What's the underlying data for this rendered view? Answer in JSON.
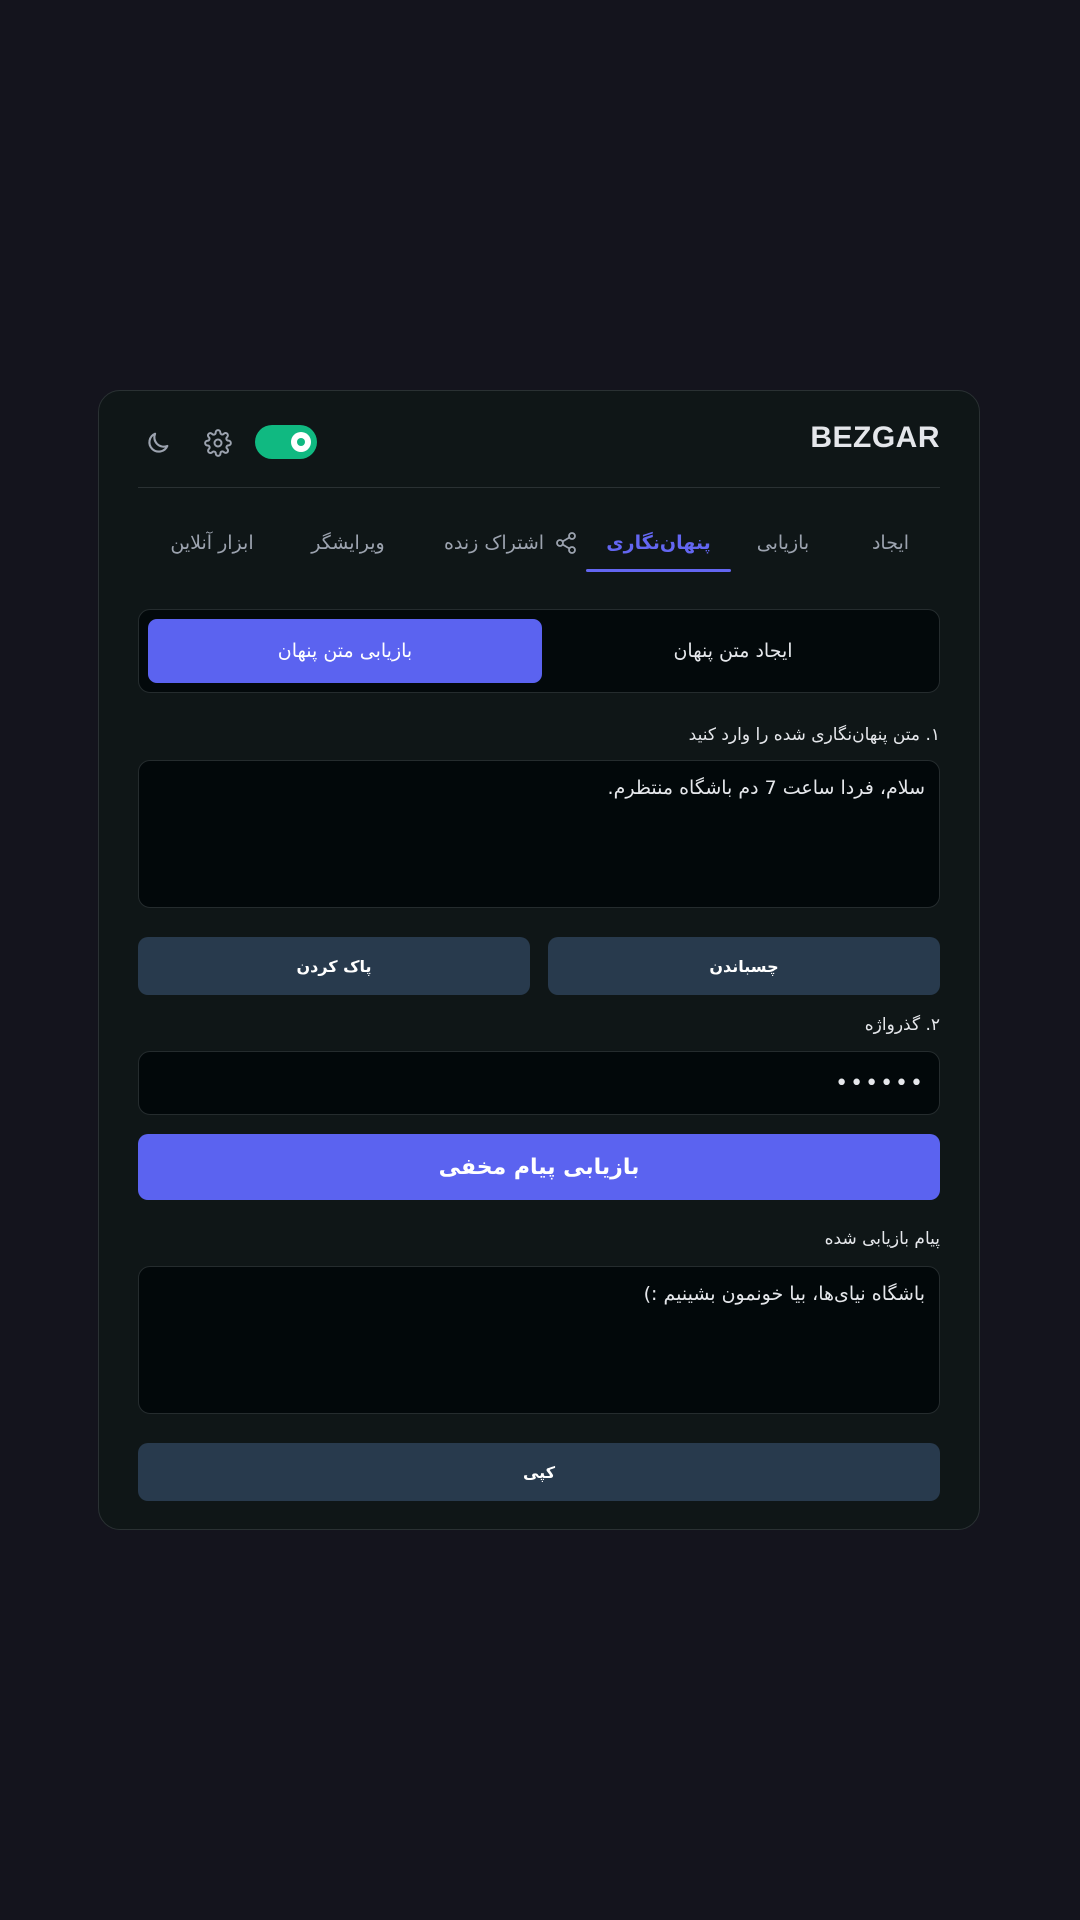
{
  "app": {
    "title": "BEZGAR"
  },
  "header": {
    "theme_icon": "moon-icon",
    "settings_icon": "gear-icon",
    "toggle_on": true,
    "toggle_color": "#10b981"
  },
  "tabs": [
    {
      "label": "ایجاد",
      "active": false
    },
    {
      "label": "بازیابی",
      "active": false
    },
    {
      "label": "پنهان‌نگاری",
      "active": true
    },
    {
      "label": "اشتراک زنده",
      "active": false,
      "icon": "share-icon"
    },
    {
      "label": "ویرایشگر",
      "active": false
    },
    {
      "label": "ابزار آنلاین",
      "active": false
    }
  ],
  "modes": {
    "create_label": "ایجاد متن پنهان",
    "extract_label": "بازیابی متن پنهان",
    "active": "extract"
  },
  "step1": {
    "label": "۱. متن پنهان‌نگاری شده را وارد کنید",
    "value": "سلام، فردا ساعت 7 دم باشگاه منتظرم."
  },
  "actions": {
    "paste_label": "چسباندن",
    "clear_label": "پاک کردن"
  },
  "step2": {
    "label": "۲. گذرواژه",
    "value": "••••••"
  },
  "submit_label": "بازیابی پیام مخفی",
  "result": {
    "label": "پیام بازیابی شده",
    "value": "باشگاه نیای‌ها، بیا خونمون بشینیم :)",
    "copy_label": "کپی"
  },
  "colors": {
    "accent": "#5b63f0",
    "tab_active": "#6366f1",
    "secondary_button": "#283a4d",
    "background": "#14141d",
    "card": "#0f1617"
  }
}
